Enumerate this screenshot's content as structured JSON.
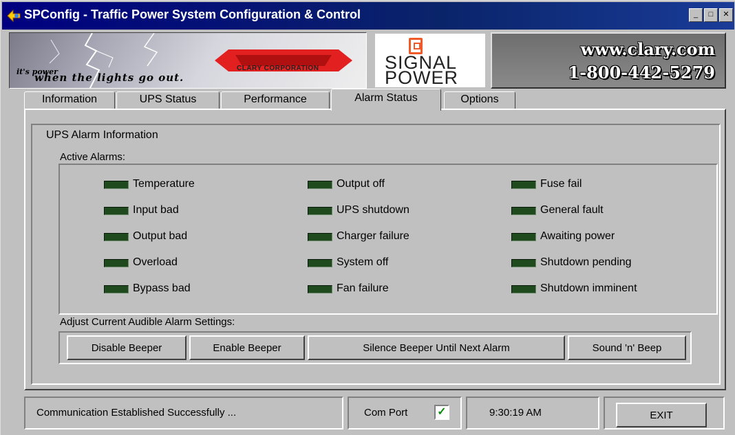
{
  "window": {
    "title": "SPConfig - Traffic Power System Configuration & Control",
    "min_label": "_",
    "max_label": "□",
    "close_label": "✕"
  },
  "banner": {
    "tagline_top": "it's power",
    "tagline_bottom": "when the lights go out.",
    "company": "CLARY CORPORATION",
    "logo_word": "CLARY",
    "signal_line1": "SIGNAL",
    "signal_line2": "POWER",
    "url": "www.clary.com",
    "phone": "1-800-442-5279",
    "colors": {
      "logo_red": "#e32020",
      "signal_orange": "#f05a28"
    }
  },
  "tabs": [
    {
      "label": "Information",
      "active": false
    },
    {
      "label": "UPS Status",
      "active": false
    },
    {
      "label": "Performance",
      "active": false
    },
    {
      "label": "Alarm Status",
      "active": true
    },
    {
      "label": "Options",
      "active": false
    }
  ],
  "alarm_panel": {
    "title": "UPS Alarm Information",
    "active_label": "Active Alarms:",
    "led_color_off": "#1e4a1e",
    "columns": [
      [
        "Temperature",
        "Input bad",
        "Output bad",
        "Overload",
        "Bypass bad"
      ],
      [
        "Output off",
        "UPS shutdown",
        "Charger failure",
        "System off",
        "Fan failure"
      ],
      [
        "Fuse fail",
        "General fault",
        "Awaiting power",
        "Shutdown pending",
        "Shutdown imminent"
      ]
    ],
    "audible_label": "Adjust Current Audible Alarm Settings:",
    "buttons": {
      "disable": "Disable Beeper",
      "enable": "Enable Beeper",
      "silence": "Silence Beeper Until Next Alarm",
      "sound": "Sound 'n' Beep"
    }
  },
  "statusbar": {
    "message": "Communication Established Successfully ...",
    "com_port": "Com Port",
    "com_check": "✓",
    "time": "9:30:19 AM",
    "exit_label": "EXIT"
  }
}
